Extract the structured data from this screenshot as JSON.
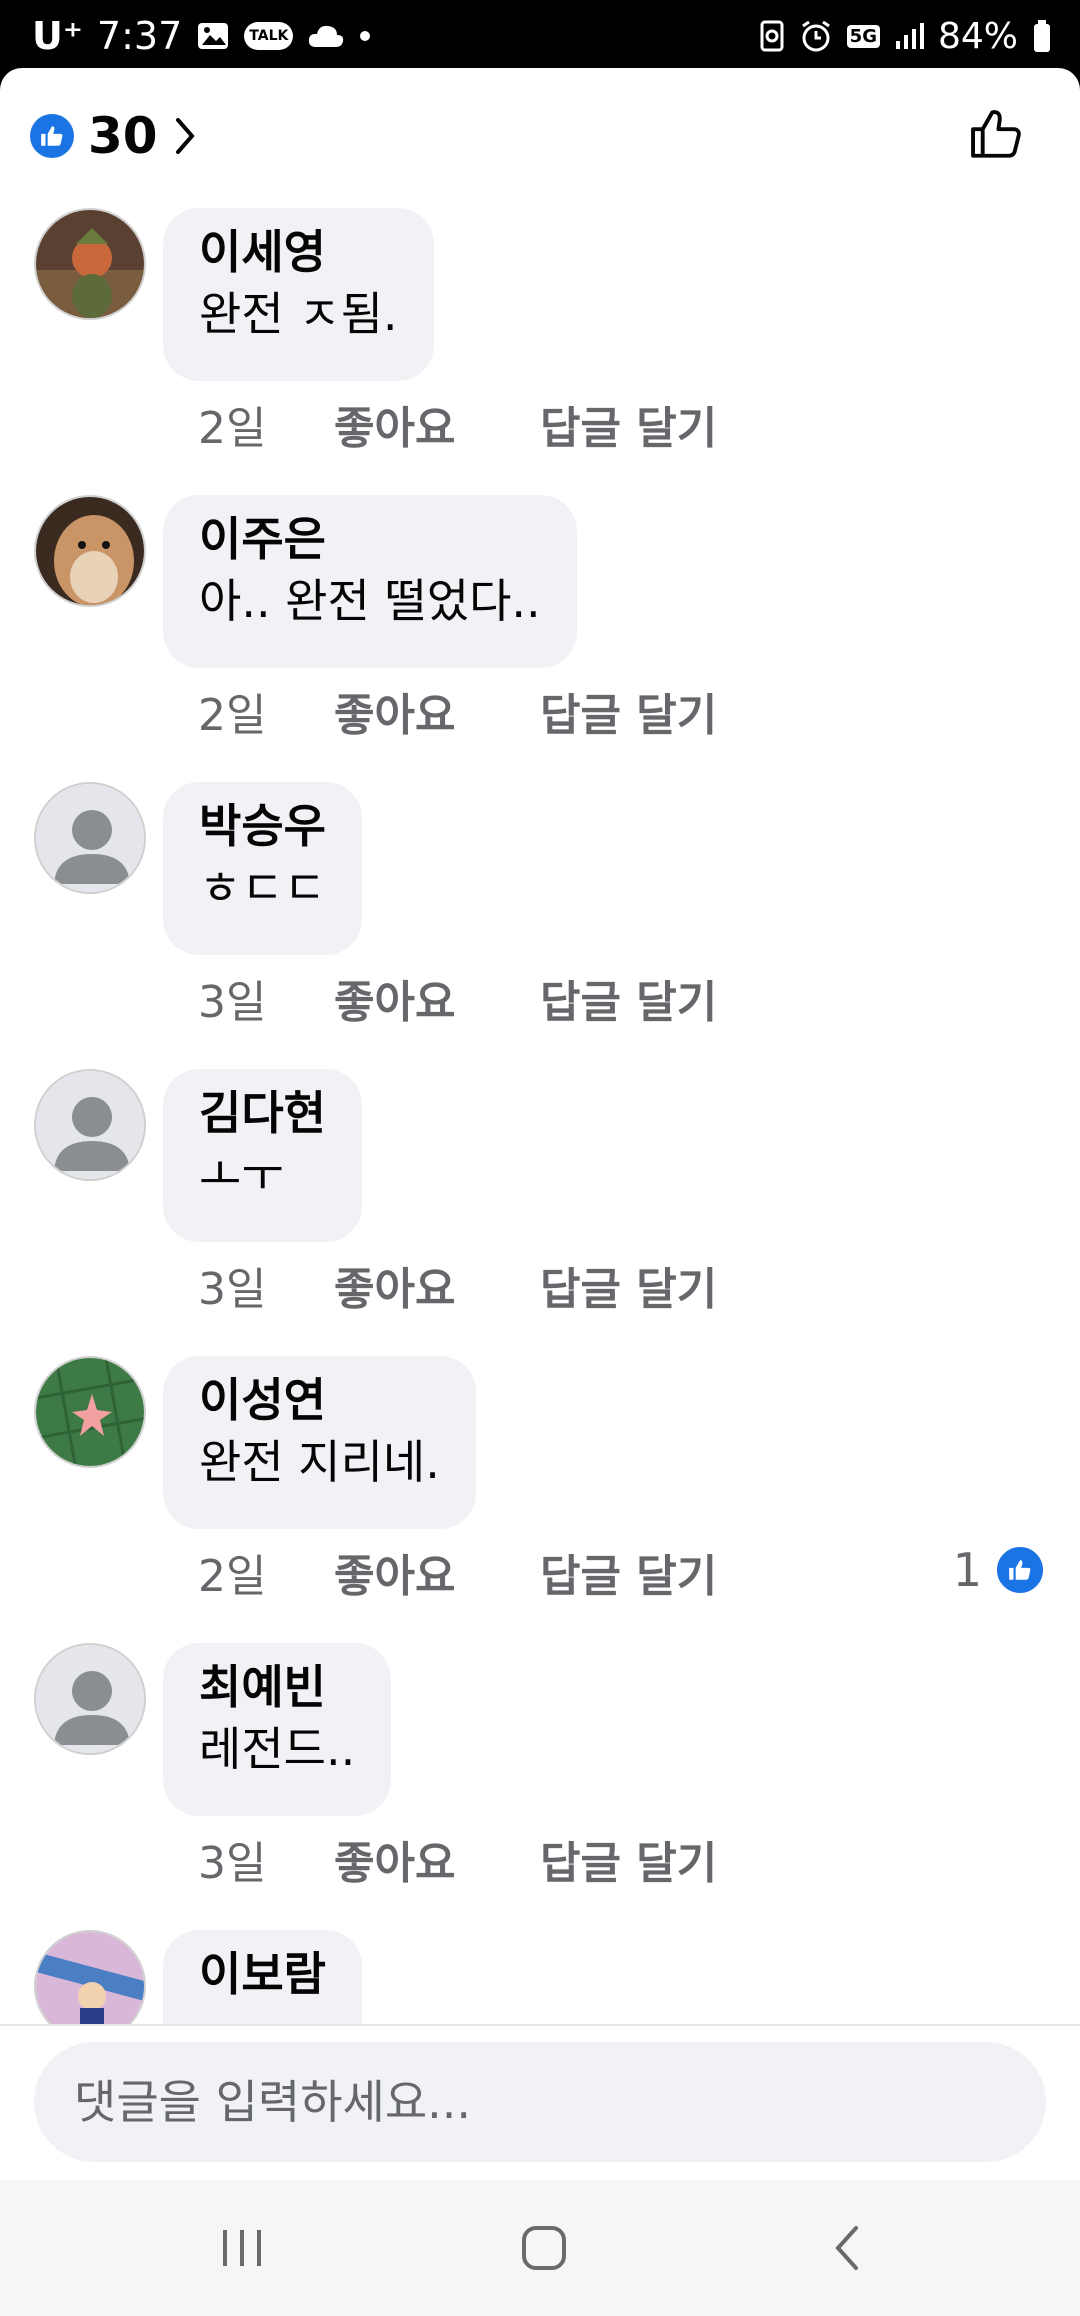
{
  "status_bar": {
    "carrier": "U⁺",
    "time": "7:37",
    "talk_label": "TALK",
    "network": "5G",
    "battery": "84%"
  },
  "header": {
    "reaction_count": "30"
  },
  "comments": [
    {
      "author": "이세영",
      "text": "완전 ㅈ됨.",
      "time": "2일",
      "like": "좋아요",
      "reply": "답글 달기",
      "avatar": "character-avatar"
    },
    {
      "author": "이주은",
      "text": "아.. 완전 떨었다..",
      "time": "2일",
      "like": "좋아요",
      "reply": "답글 달기",
      "avatar": "hamster-avatar"
    },
    {
      "author": "박승우",
      "text": "ㅎㄷㄷ",
      "time": "3일",
      "like": "좋아요",
      "reply": "답글 달기",
      "avatar": "default-avatar"
    },
    {
      "author": "김다현",
      "text": "ㅗㅜ",
      "time": "3일",
      "like": "좋아요",
      "reply": "답글 달기",
      "avatar": "default-avatar"
    },
    {
      "author": "이성연",
      "text": "완전 지리네.",
      "time": "2일",
      "like": "좋아요",
      "reply": "답글 달기",
      "reaction_count": "1",
      "avatar": "starfish-avatar"
    },
    {
      "author": "최예빈",
      "text": "레전드..",
      "time": "3일",
      "like": "좋아요",
      "reply": "답글 달기",
      "avatar": "default-avatar"
    },
    {
      "author": "이보람",
      "avatar": "cartoon-avatar"
    }
  ],
  "composer": {
    "placeholder": "댓글을 입력하세요..."
  },
  "colors": {
    "accent": "#1b74e4",
    "bubble": "#f0f2f5",
    "secondary_text": "#65676b"
  }
}
